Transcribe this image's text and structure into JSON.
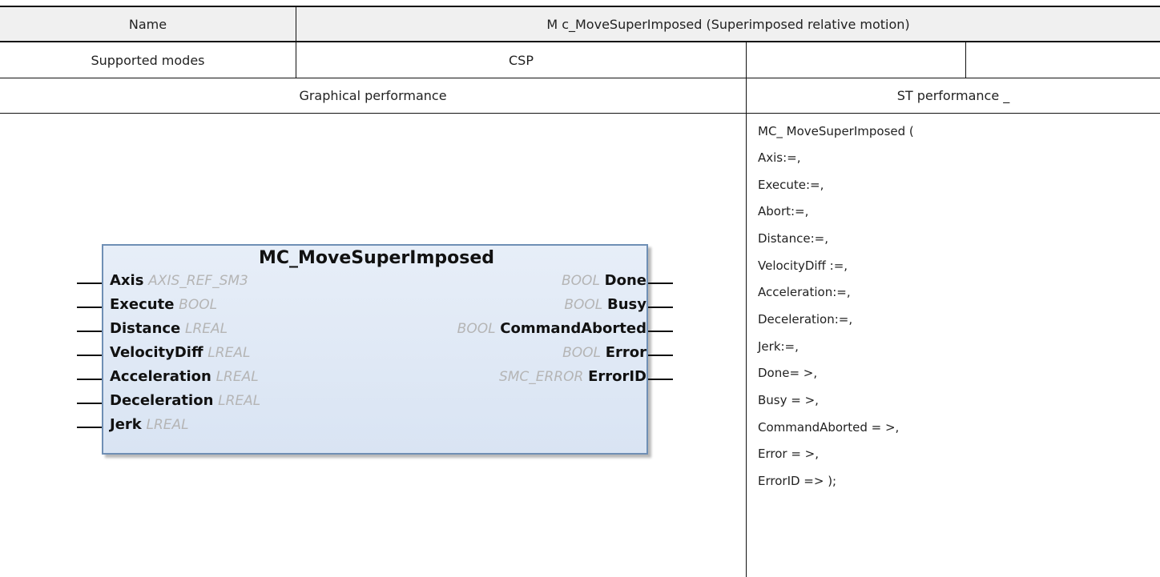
{
  "table": {
    "name_label": "Name",
    "name_value": "M c_MoveSuperImposed (Superimposed relative motion)",
    "modes_label": "Supported modes",
    "modes_value": "CSP",
    "modes_extra_1": "",
    "modes_extra_2": "",
    "graphical_label": "Graphical performance",
    "st_label": "ST performance _"
  },
  "block": {
    "title": "MC_MoveSuperImposed",
    "inputs": [
      {
        "name": "Axis",
        "type": "AXIS_REF_SM3"
      },
      {
        "name": "Execute",
        "type": "BOOL"
      },
      {
        "name": "Distance",
        "type": "LREAL"
      },
      {
        "name": "VelocityDiff",
        "type": "LREAL"
      },
      {
        "name": "Acceleration",
        "type": "LREAL"
      },
      {
        "name": "Deceleration",
        "type": "LREAL"
      },
      {
        "name": "Jerk",
        "type": "LREAL"
      }
    ],
    "outputs": [
      {
        "name": "Done",
        "type": "BOOL"
      },
      {
        "name": "Busy",
        "type": "BOOL"
      },
      {
        "name": "CommandAborted",
        "type": "BOOL"
      },
      {
        "name": "Error",
        "type": "BOOL"
      },
      {
        "name": "ErrorID",
        "type": "SMC_ERROR"
      }
    ]
  },
  "st_lines": [
    "MC_ MoveSuperImposed (",
    "Axis:=,",
    "Execute:=,",
    "Abort:=,",
    "Distance:=,",
    "VelocityDiff :=,",
    "Acceleration:=,",
    "Deceleration:=,",
    "Jerk:=,",
    "Done= >,",
    "Busy = >,",
    "CommandAborted = >,",
    "Error = >,",
    "ErrorID => );"
  ]
}
